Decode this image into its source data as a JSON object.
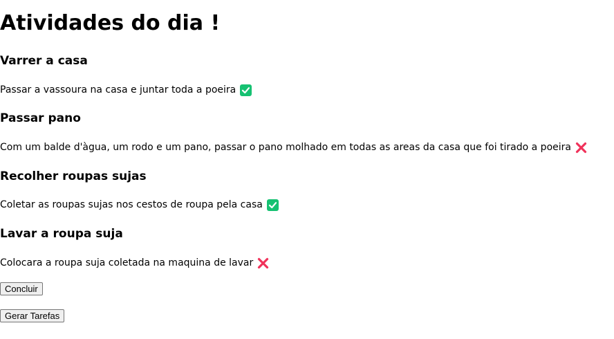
{
  "page": {
    "title": "Atividades do dia !"
  },
  "tasks": [
    {
      "title": "Varrer a casa",
      "description": "Passar a vassoura na casa e juntar toda a poeira",
      "status": "done",
      "status_icon": "check-mark-icon",
      "status_color": "#16c172"
    },
    {
      "title": "Passar pano",
      "description": "Com um balde d'àgua, um rodo e um pano, passar o pano molhado em todas as areas da casa que foi tirado a poeira",
      "status": "not-done",
      "status_icon": "cross-mark-icon",
      "status_color": "#f0325a"
    },
    {
      "title": "Recolher roupas sujas",
      "description": "Coletar as roupas sujas nos cestos de roupa pela casa",
      "status": "done",
      "status_icon": "check-mark-icon",
      "status_color": "#16c172"
    },
    {
      "title": "Lavar a roupa suja",
      "description": "Colocara a roupa suja coletada na maquina de lavar",
      "status": "not-done",
      "status_icon": "cross-mark-icon",
      "status_color": "#f0325a"
    }
  ],
  "buttons": {
    "conclude_label": "Concluir",
    "generate_label": "Gerar Tarefas"
  }
}
